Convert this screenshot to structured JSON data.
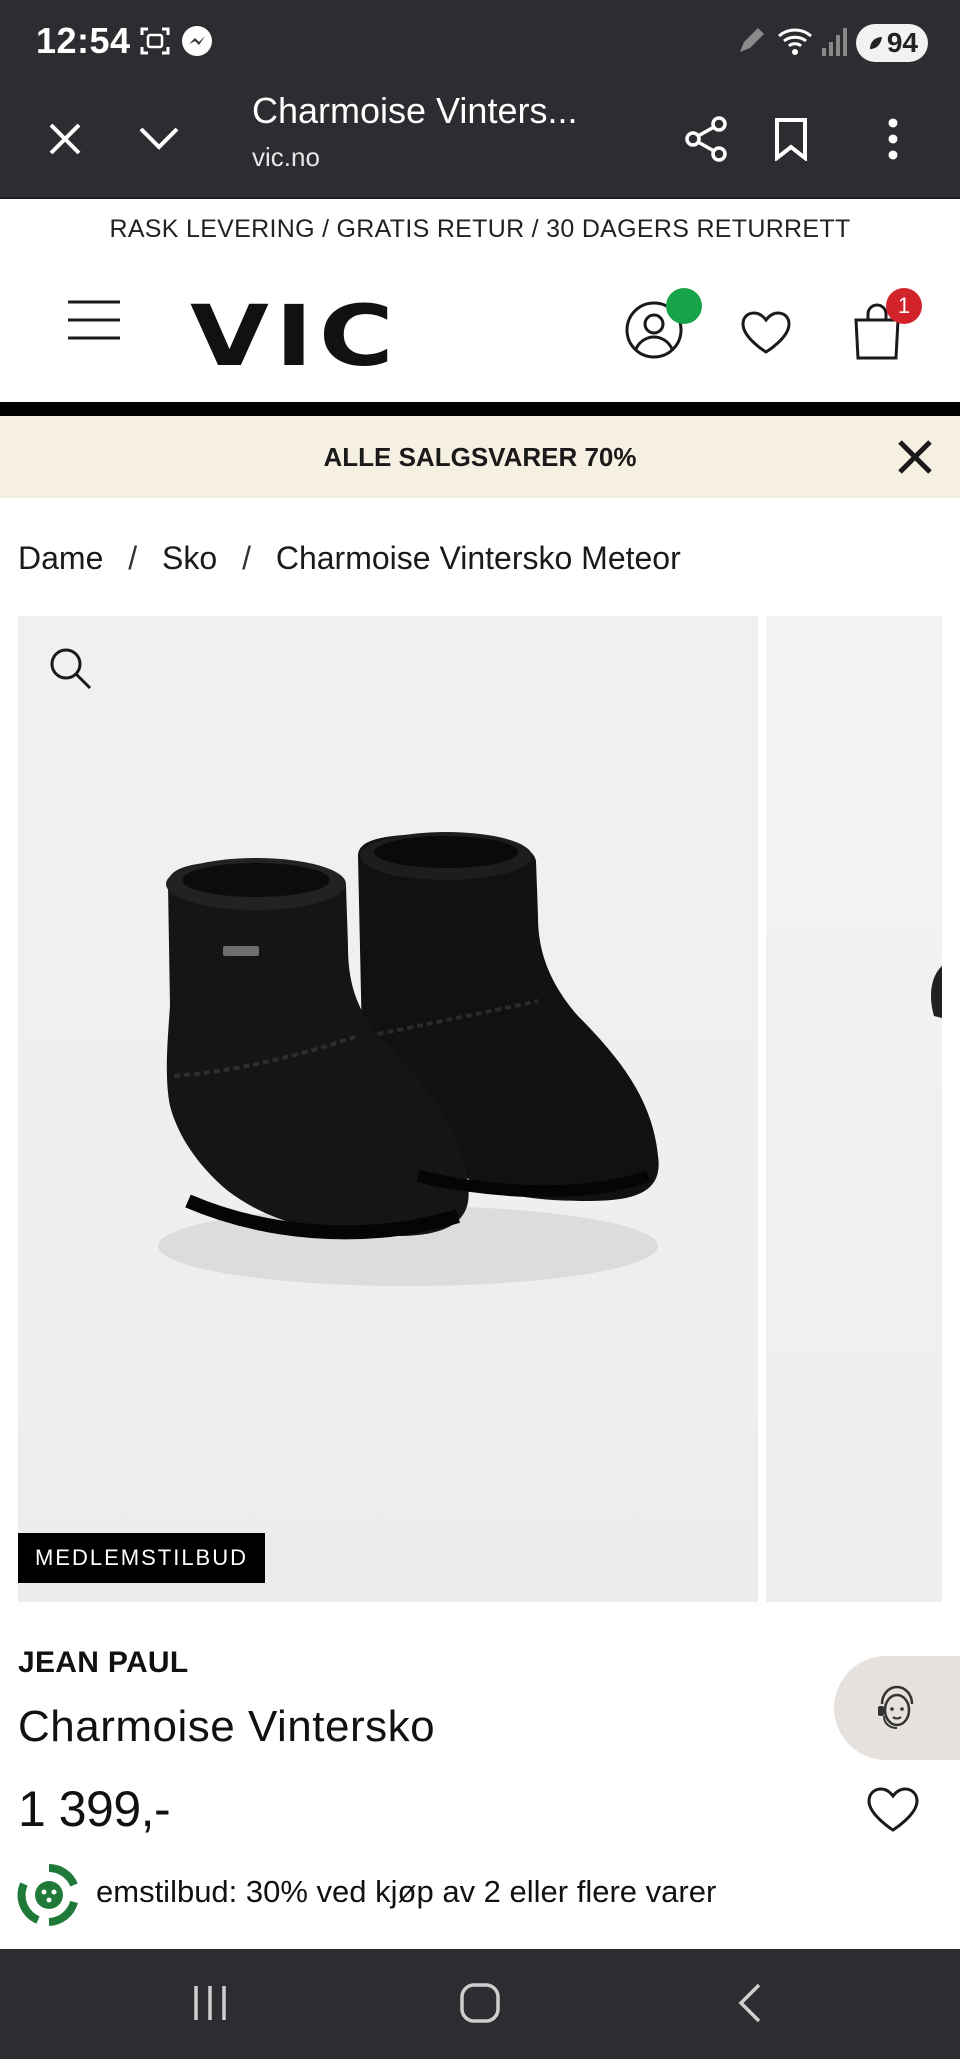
{
  "status_bar": {
    "time": "12:54",
    "battery": "94",
    "icons": [
      "screenshot-icon",
      "messenger-icon",
      "pen-icon",
      "wifi-icon",
      "signal-icon",
      "battery-icon"
    ]
  },
  "browser": {
    "title": "Charmoise Vinters...",
    "url": "vic.no",
    "buttons": [
      "close-icon",
      "chevron-down-icon",
      "share-icon",
      "bookmark-icon",
      "more-vertical-icon"
    ]
  },
  "promo_banner": "RASK LEVERING / GRATIS RETUR / 30 DAGERS RETURRETT",
  "header": {
    "logo": "VIC",
    "cart_count": "1",
    "colors": {
      "account_dot": "#17a34a",
      "cart_badge": "#d2232a"
    }
  },
  "sale_bar": {
    "text": "ALLE SALGSVARER 70%"
  },
  "breadcrumb": {
    "items": [
      "Dame",
      "Sko",
      "Charmoise Vintersko Meteor"
    ],
    "separator": "/"
  },
  "gallery": {
    "badge": "MEDLEMSTILBUD"
  },
  "product": {
    "brand": "JEAN PAUL",
    "name": "Charmoise Vintersko",
    "price": "1 399,-",
    "offer": "emstilbud: 30% ved kjøp av 2 eller flere varer"
  },
  "colors": {
    "chrome": "#2b2d31",
    "sale_bar_bg": "#f6f0e3",
    "chat_bg": "#e6e1dc",
    "loyalty_green": "#1f7a3a"
  }
}
